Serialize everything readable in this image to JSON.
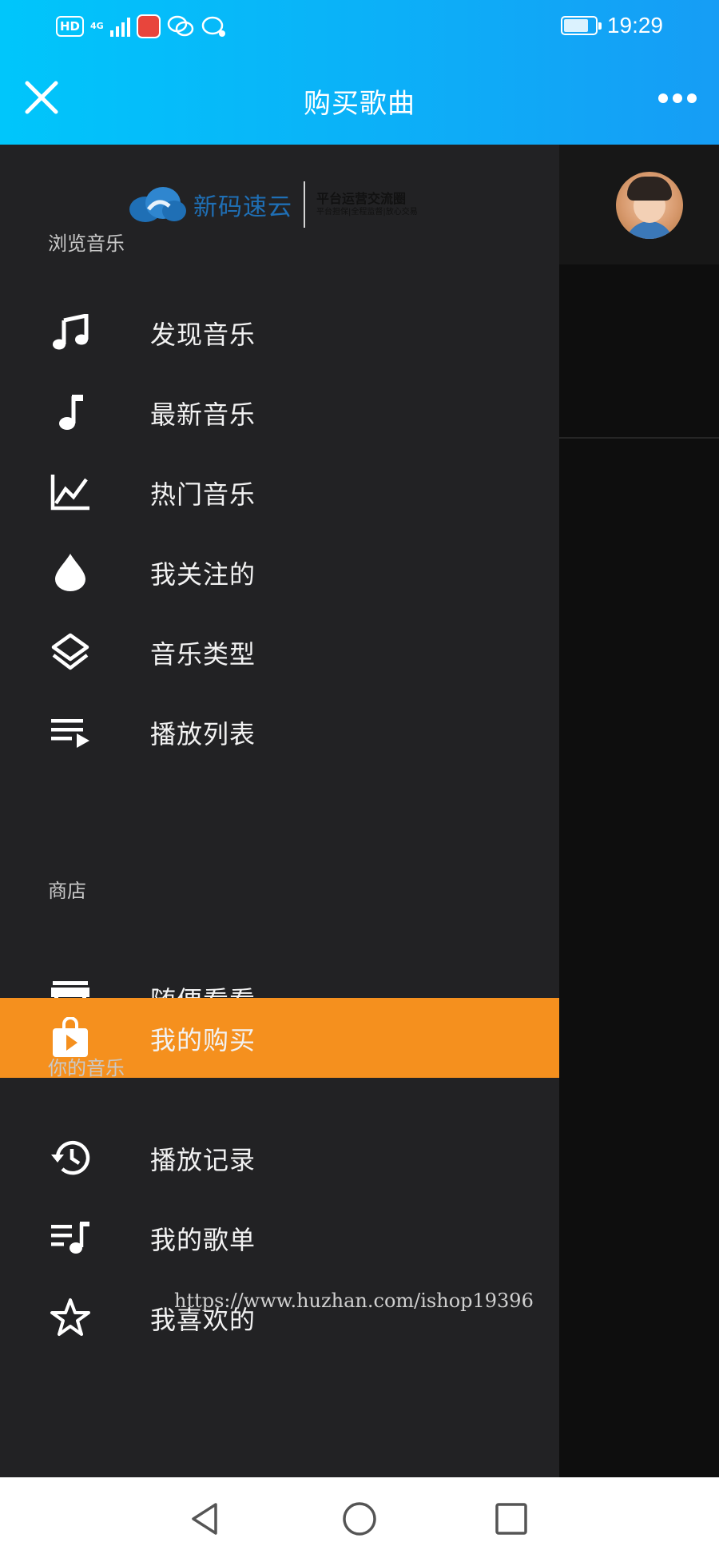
{
  "status_bar": {
    "hd_label": "HD",
    "network_label": "4G",
    "time": "19:29"
  },
  "app_bar": {
    "title": "购买歌曲",
    "close_icon": "close-icon",
    "more_icon": "more-horizontal-icon"
  },
  "drawer": {
    "logo": {
      "main_text": "新码速云",
      "tagline_1": "平台运营交流圈",
      "tagline_2": "平台担保|全程监督|放心交易"
    },
    "sections": [
      {
        "title": "浏览音乐",
        "items": [
          {
            "label": "发现音乐",
            "icon": "music-notes-icon"
          },
          {
            "label": "最新音乐",
            "icon": "music-note-icon"
          },
          {
            "label": "热门音乐",
            "icon": "trending-chart-icon"
          },
          {
            "label": "我关注的",
            "icon": "drop-icon"
          },
          {
            "label": "音乐类型",
            "icon": "layers-icon"
          },
          {
            "label": "播放列表",
            "icon": "playlist-play-icon"
          }
        ]
      },
      {
        "title": "商店",
        "items": [
          {
            "label": "随便看看",
            "icon": "store-icon"
          },
          {
            "label": "我的购买",
            "icon": "shopping-bag-play-icon",
            "active": true
          }
        ]
      },
      {
        "title": "你的音乐",
        "items": [
          {
            "label": "播放记录",
            "icon": "history-icon"
          },
          {
            "label": "我的歌单",
            "icon": "queue-music-icon"
          },
          {
            "label": "我喜欢的",
            "icon": "star-outline-icon"
          }
        ]
      }
    ],
    "active_color": "#f5901e",
    "background_color": "#222224"
  },
  "watermark": "https://www.huzhan.com/ishop19396",
  "nav_bar": {
    "back_icon": "nav-back-icon",
    "home_icon": "nav-home-icon",
    "recents_icon": "nav-recents-icon"
  },
  "colors": {
    "app_bar_gradient_start": "#00c6fb",
    "app_bar_gradient_end": "#169df5"
  }
}
